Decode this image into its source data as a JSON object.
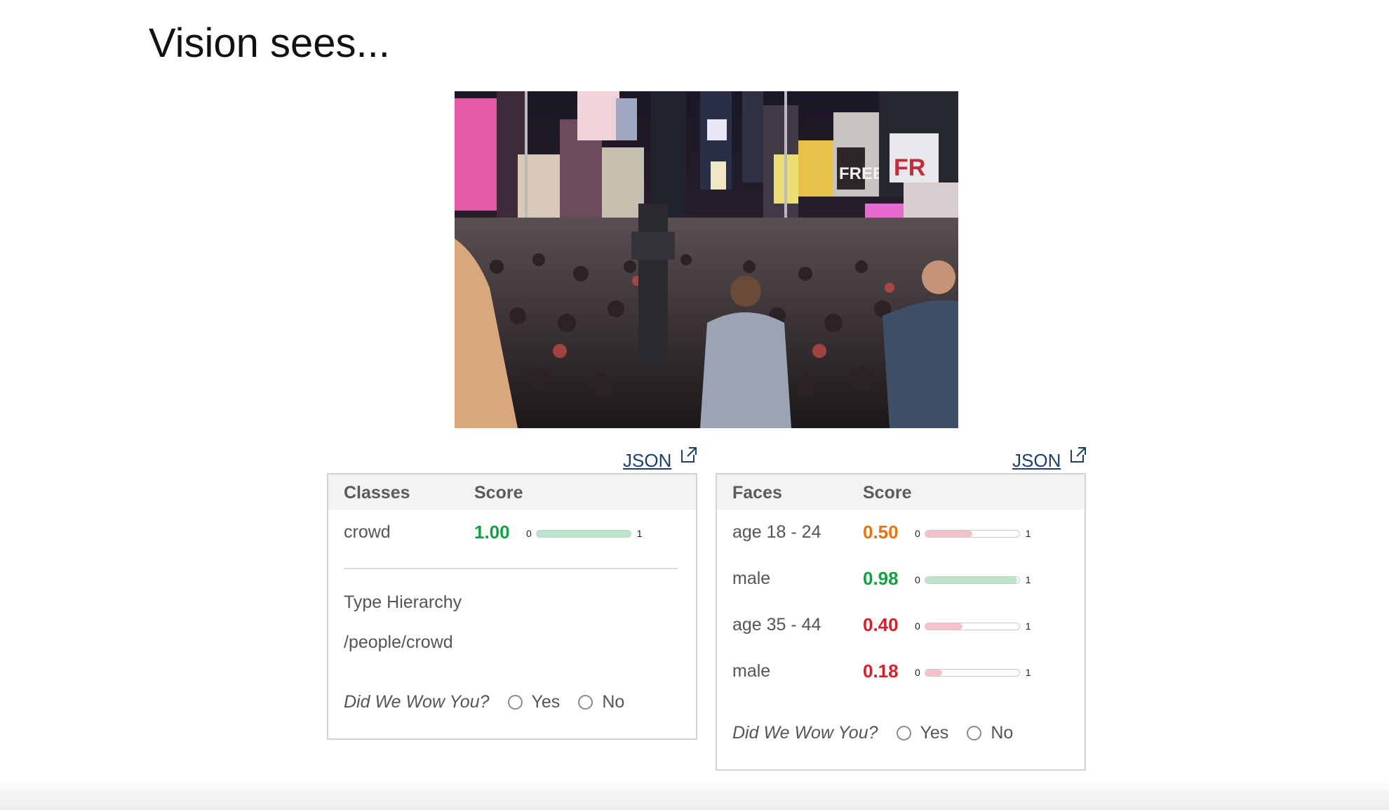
{
  "page": {
    "title": "Vision sees..."
  },
  "colors": {
    "high": "#13a041",
    "medium": "#e8740c",
    "low": "#d6202c",
    "bar_high": "#b9e6cb",
    "bar_low": "#f5c2c9"
  },
  "classes_panel": {
    "json_link": "JSON",
    "header": {
      "col1": "Classes",
      "col2": "Score"
    },
    "rows": [
      {
        "label": "crowd",
        "score": "1.00",
        "value": 1.0,
        "level": "high"
      }
    ],
    "hierarchy_label": "Type Hierarchy",
    "hierarchy_value": "/people/crowd",
    "bar_min": "0",
    "bar_max": "1",
    "feedback": {
      "question": "Did We Wow You?",
      "yes": "Yes",
      "no": "No"
    }
  },
  "faces_panel": {
    "json_link": "JSON",
    "header": {
      "col1": "Faces",
      "col2": "Score"
    },
    "rows": [
      {
        "label": "age 18 - 24",
        "score": "0.50",
        "value": 0.5,
        "level": "medium"
      },
      {
        "label": "male",
        "score": "0.98",
        "value": 0.98,
        "level": "high"
      },
      {
        "label": "age 35 - 44",
        "score": "0.40",
        "value": 0.4,
        "level": "low"
      },
      {
        "label": "male",
        "score": "0.18",
        "value": 0.18,
        "level": "low"
      }
    ],
    "bar_min": "0",
    "bar_max": "1",
    "feedback": {
      "question": "Did We Wow You?",
      "yes": "Yes",
      "no": "No"
    }
  },
  "image": {
    "icon": "photo-icon",
    "billboard_texts": [
      "FREE",
      "FR"
    ]
  }
}
